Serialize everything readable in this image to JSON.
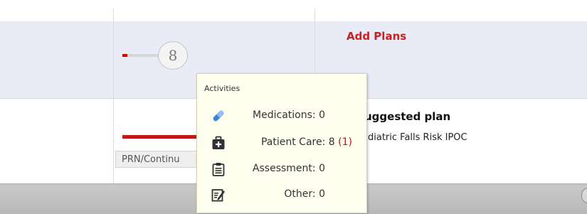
{
  "plans_row": {
    "activity_count": "8",
    "progress_fraction": 0.12,
    "add_plans_label": "Add Plans"
  },
  "suggested_row": {
    "title": "uggested plan",
    "subtitle": "diatric Falls Risk IPOC",
    "prn_chip_text": "PRN/Continu"
  },
  "tooltip": {
    "title": "Activities",
    "items": [
      {
        "icon": "pill-icon",
        "label": "Medications:",
        "value": "0",
        "extra": ""
      },
      {
        "icon": "medical-bag-icon",
        "label": "Patient Care:",
        "value": "8",
        "extra": "(1)"
      },
      {
        "icon": "clipboard-icon",
        "label": "Assessment:",
        "value": "0",
        "extra": ""
      },
      {
        "icon": "edit-document-icon",
        "label": "Other:",
        "value": "0",
        "extra": ""
      }
    ]
  },
  "colors": {
    "accent_red": "#cc1f1f",
    "highlight_row": "#e9ebf6",
    "tooltip_bg": "#fffff0",
    "icon_blue": "#3a86d6",
    "icon_dark": "#2f3236"
  }
}
